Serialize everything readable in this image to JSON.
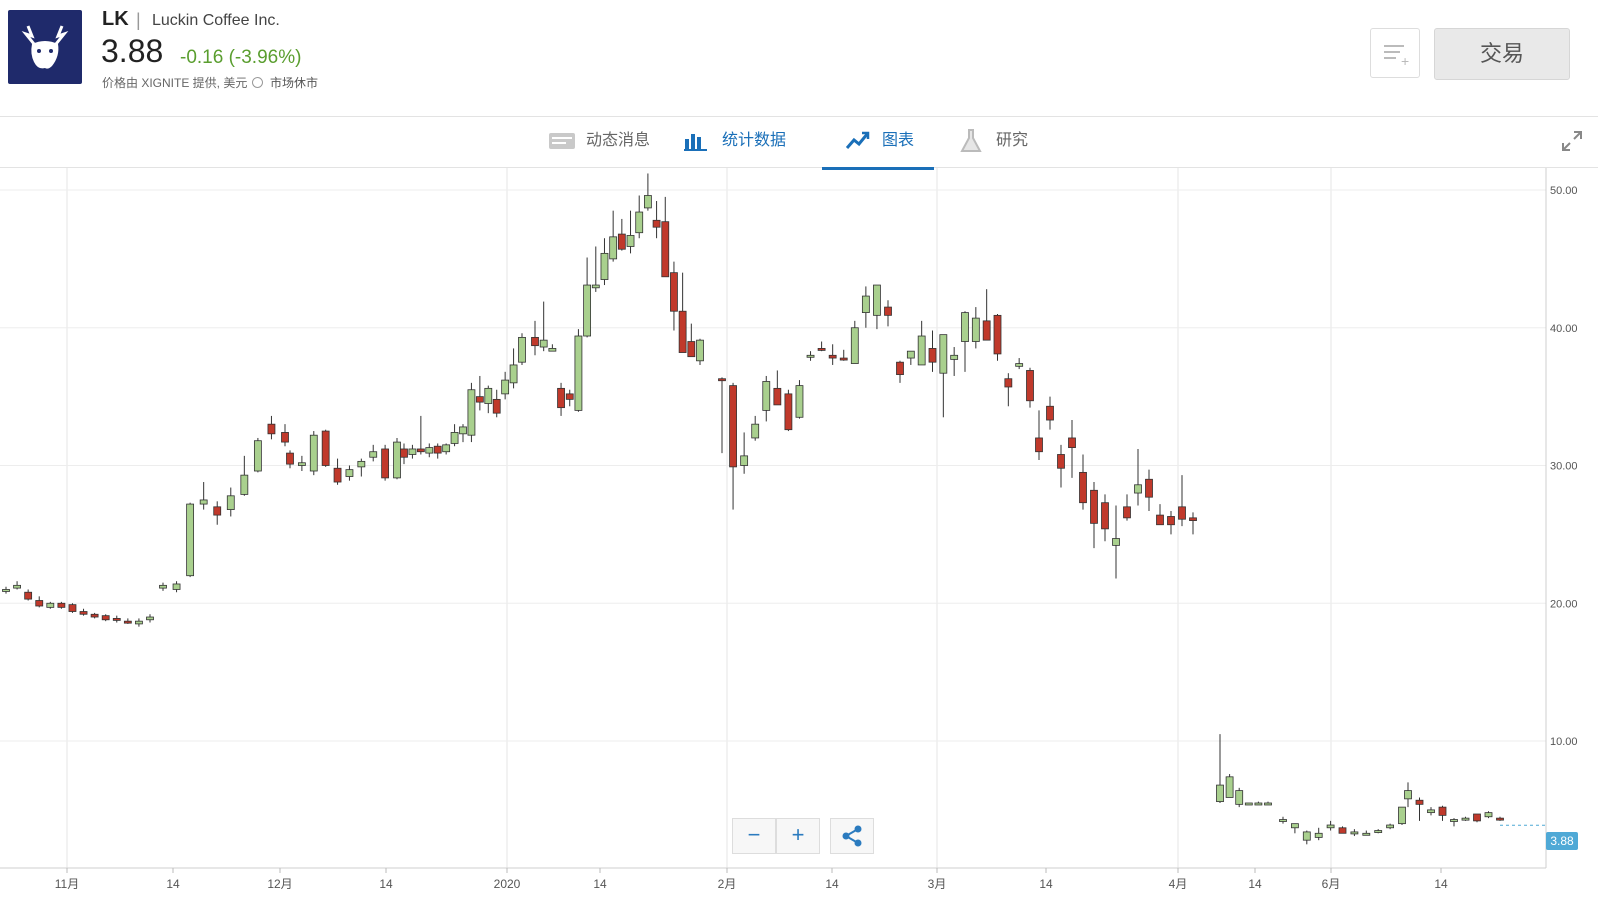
{
  "header": {
    "ticker": "LK",
    "separator": "|",
    "company": "Luckin Coffee Inc.",
    "price": "3.88",
    "change": "-0.16 (-3.96%)",
    "source": "价格由 XIGNITE 提供, 美元",
    "market_status": "市场休市",
    "trade_label": "交易",
    "logo_icon": "deer-logo-icon",
    "accent_color": "#1f2a6b",
    "change_color": "#5a9e2f"
  },
  "tabs": [
    {
      "label": "动态消息",
      "icon": "news-icon",
      "active": false
    },
    {
      "label": "统计数据",
      "icon": "bar-chart-icon",
      "active": false
    },
    {
      "label": "图表",
      "icon": "trend-chart-icon",
      "active": true
    },
    {
      "label": "研究",
      "icon": "flask-icon",
      "active": false
    }
  ],
  "chart_controls": {
    "zoom_out": "−",
    "zoom_in": "+"
  },
  "chart_data": {
    "type": "candlestick",
    "title": "",
    "ylim": [
      0,
      53
    ],
    "y_ticks": [
      "50.00",
      "40.00",
      "30.00",
      "20.00",
      "10.00"
    ],
    "x_ticks": [
      "11月",
      "14",
      "12月",
      "14",
      "2020",
      "14",
      "2月",
      "14",
      "3月",
      "14",
      "4月",
      "14",
      "6月",
      "14"
    ],
    "last_price": "3.88",
    "up_color": "#a9d08e",
    "down_color": "#c0392b",
    "candles": [
      [
        20.9,
        21.2,
        20.7,
        21.0
      ],
      [
        21.1,
        21.6,
        21.0,
        21.3
      ],
      [
        20.8,
        21.0,
        20.2,
        20.3
      ],
      [
        20.2,
        20.5,
        19.7,
        19.8
      ],
      [
        19.7,
        20.1,
        19.6,
        20.0
      ],
      [
        20.0,
        20.1,
        19.6,
        19.7
      ],
      [
        19.9,
        20.0,
        19.3,
        19.4
      ],
      [
        19.4,
        19.6,
        19.1,
        19.2
      ],
      [
        19.2,
        19.3,
        18.9,
        19.0
      ],
      [
        19.1,
        19.2,
        18.7,
        18.8
      ],
      [
        18.9,
        19.1,
        18.6,
        18.8
      ],
      [
        18.7,
        18.9,
        18.5,
        18.6
      ],
      [
        18.5,
        18.9,
        18.3,
        18.7
      ],
      [
        18.8,
        19.2,
        18.6,
        19.0
      ],
      [
        21.1,
        21.5,
        20.9,
        21.3
      ],
      [
        21.0,
        21.6,
        20.8,
        21.4
      ],
      [
        22.0,
        27.3,
        21.9,
        27.2
      ],
      [
        27.2,
        28.8,
        26.8,
        27.5
      ],
      [
        27.0,
        27.4,
        25.7,
        26.4
      ],
      [
        26.8,
        28.4,
        26.3,
        27.8
      ],
      [
        27.9,
        30.7,
        27.8,
        29.3
      ],
      [
        29.6,
        32.0,
        29.5,
        31.8
      ],
      [
        33.0,
        33.6,
        31.9,
        32.3
      ],
      [
        32.4,
        33.0,
        31.4,
        31.7
      ],
      [
        30.9,
        31.1,
        29.8,
        30.1
      ],
      [
        30.0,
        30.7,
        29.6,
        30.2
      ],
      [
        29.6,
        32.5,
        29.3,
        32.2
      ],
      [
        32.5,
        32.6,
        29.9,
        30.0
      ],
      [
        29.8,
        30.5,
        28.6,
        28.8
      ],
      [
        29.2,
        30.0,
        28.9,
        29.7
      ],
      [
        29.9,
        30.5,
        29.2,
        30.3
      ],
      [
        30.6,
        31.5,
        30.3,
        31.0
      ],
      [
        31.2,
        31.5,
        28.9,
        29.1
      ],
      [
        29.1,
        32.0,
        29.0,
        31.7
      ],
      [
        31.2,
        31.6,
        30.1,
        30.6
      ],
      [
        30.8,
        31.5,
        30.5,
        31.2
      ],
      [
        31.2,
        33.6,
        30.8,
        31.0
      ],
      [
        30.9,
        31.6,
        30.6,
        31.3
      ],
      [
        31.4,
        31.6,
        30.5,
        30.9
      ],
      [
        31.0,
        31.6,
        30.8,
        31.5
      ],
      [
        31.6,
        33.0,
        31.4,
        32.4
      ],
      [
        32.3,
        33.0,
        31.7,
        32.8
      ],
      [
        32.2,
        36.0,
        31.7,
        35.5
      ],
      [
        35.0,
        36.5,
        34.0,
        34.6
      ],
      [
        34.5,
        35.8,
        33.8,
        35.6
      ],
      [
        34.8,
        35.5,
        33.5,
        33.8
      ],
      [
        35.2,
        36.8,
        34.8,
        36.2
      ],
      [
        36.0,
        38.5,
        35.6,
        37.3
      ],
      [
        37.5,
        39.6,
        37.3,
        39.3
      ],
      [
        39.3,
        40.5,
        38.0,
        38.7
      ],
      [
        38.6,
        41.9,
        38.3,
        39.1
      ],
      [
        38.3,
        38.8,
        38.3,
        38.5
      ],
      [
        35.6,
        36.0,
        33.6,
        34.2
      ],
      [
        35.2,
        35.5,
        34.3,
        34.8
      ],
      [
        34.0,
        39.9,
        33.9,
        39.4
      ],
      [
        39.4,
        45.1,
        39.3,
        43.1
      ],
      [
        42.9,
        45.9,
        42.6,
        43.1
      ],
      [
        43.5,
        46.5,
        43.1,
        45.4
      ],
      [
        45.0,
        48.5,
        44.8,
        46.6
      ],
      [
        46.8,
        47.9,
        45.6,
        45.7
      ],
      [
        45.9,
        48.5,
        45.4,
        46.7
      ],
      [
        46.9,
        49.6,
        46.5,
        48.4
      ],
      [
        48.7,
        51.2,
        48.5,
        49.6
      ],
      [
        47.8,
        49.2,
        46.5,
        47.3
      ],
      [
        47.7,
        49.5,
        44.2,
        43.7
      ],
      [
        44.0,
        44.8,
        39.8,
        41.2
      ],
      [
        41.2,
        44.0,
        39.5,
        38.2
      ],
      [
        39.0,
        40.3,
        38.7,
        37.9
      ],
      [
        37.6,
        39.2,
        37.3,
        39.1
      ],
      [
        36.3,
        36.4,
        30.9,
        36.2
      ],
      [
        35.8,
        36.0,
        26.8,
        29.9
      ],
      [
        30.0,
        32.4,
        29.4,
        30.7
      ],
      [
        32.0,
        33.6,
        31.8,
        33.0
      ],
      [
        34.0,
        36.5,
        33.2,
        36.1
      ],
      [
        35.6,
        36.9,
        34.5,
        34.4
      ],
      [
        35.2,
        35.5,
        32.5,
        32.6
      ],
      [
        33.5,
        36.2,
        33.4,
        35.8
      ],
      [
        37.9,
        38.3,
        37.6,
        38.0
      ],
      [
        38.5,
        39.0,
        38.3,
        38.4
      ],
      [
        38.0,
        38.8,
        37.3,
        37.8
      ],
      [
        37.8,
        38.4,
        37.6,
        37.7
      ],
      [
        37.4,
        40.5,
        37.4,
        40.0
      ],
      [
        41.1,
        43.0,
        40.0,
        42.3
      ],
      [
        40.9,
        43.0,
        39.9,
        43.1
      ],
      [
        41.5,
        42.0,
        40.1,
        40.9
      ],
      [
        37.5,
        37.6,
        36.0,
        36.6
      ],
      [
        37.8,
        38.2,
        37.3,
        38.3
      ],
      [
        37.3,
        40.5,
        37.3,
        39.4
      ],
      [
        38.5,
        39.8,
        36.8,
        37.5
      ],
      [
        36.7,
        37.9,
        33.5,
        39.5
      ],
      [
        37.7,
        38.6,
        36.5,
        38.0
      ],
      [
        39.0,
        41.2,
        36.8,
        41.1
      ],
      [
        39.0,
        41.5,
        38.5,
        40.7
      ],
      [
        40.5,
        42.8,
        40.5,
        39.1
      ],
      [
        40.9,
        41.0,
        37.6,
        38.1
      ],
      [
        36.3,
        36.7,
        34.3,
        35.7
      ],
      [
        37.2,
        37.8,
        37.0,
        37.4
      ],
      [
        36.9,
        37.1,
        34.2,
        34.7
      ],
      [
        32.0,
        34.0,
        30.4,
        31.0
      ],
      [
        34.3,
        35.0,
        32.6,
        33.3
      ],
      [
        30.8,
        31.5,
        28.4,
        29.8
      ],
      [
        32.0,
        33.3,
        29.1,
        31.3
      ],
      [
        29.5,
        30.8,
        26.8,
        27.3
      ],
      [
        28.2,
        28.8,
        24.0,
        25.8
      ],
      [
        27.3,
        27.9,
        24.5,
        25.4
      ],
      [
        24.2,
        27.1,
        21.8,
        24.7
      ],
      [
        27.0,
        27.9,
        26.0,
        26.2
      ],
      [
        28.0,
        31.2,
        27.1,
        28.6
      ],
      [
        29.0,
        29.7,
        26.7,
        27.7
      ],
      [
        26.4,
        27.2,
        25.8,
        25.7
      ],
      [
        26.3,
        26.7,
        25.0,
        25.7
      ],
      [
        27.0,
        29.3,
        25.6,
        26.1
      ],
      [
        26.2,
        26.6,
        25.0,
        26.0
      ],
      [
        5.6,
        10.5,
        5.5,
        6.8
      ],
      [
        5.9,
        7.6,
        5.9,
        7.4
      ],
      [
        5.4,
        6.6,
        5.2,
        6.4
      ],
      [
        5.5,
        5.5,
        5.4,
        5.5
      ],
      [
        5.5,
        5.6,
        5.5,
        5.5
      ],
      [
        5.5,
        5.6,
        5.4,
        5.5
      ],
      [
        4.2,
        4.5,
        4.0,
        4.3
      ],
      [
        3.7,
        4.0,
        3.3,
        4.0
      ],
      [
        2.8,
        3.5,
        2.5,
        3.4
      ],
      [
        3.0,
        3.7,
        2.8,
        3.3
      ],
      [
        3.7,
        4.2,
        3.5,
        3.9
      ],
      [
        3.7,
        3.8,
        3.4,
        3.3
      ],
      [
        3.3,
        3.6,
        3.1,
        3.4
      ],
      [
        3.3,
        3.5,
        3.2,
        3.3
      ],
      [
        3.4,
        3.6,
        3.3,
        3.5
      ],
      [
        3.7,
        4.0,
        3.6,
        3.9
      ],
      [
        4.0,
        5.2,
        3.9,
        5.2
      ],
      [
        5.8,
        7.0,
        5.2,
        6.4
      ],
      [
        5.7,
        5.9,
        4.2,
        5.4
      ],
      [
        4.8,
        5.2,
        4.6,
        5.0
      ],
      [
        5.2,
        5.3,
        4.2,
        4.6
      ],
      [
        4.2,
        4.4,
        3.8,
        4.3
      ],
      [
        4.3,
        4.5,
        4.2,
        4.4
      ],
      [
        4.7,
        4.2,
        4.1,
        4.2
      ],
      [
        4.5,
        4.9,
        4.4,
        4.8
      ],
      [
        4.4,
        4.5,
        4.2,
        4.3
      ]
    ]
  }
}
